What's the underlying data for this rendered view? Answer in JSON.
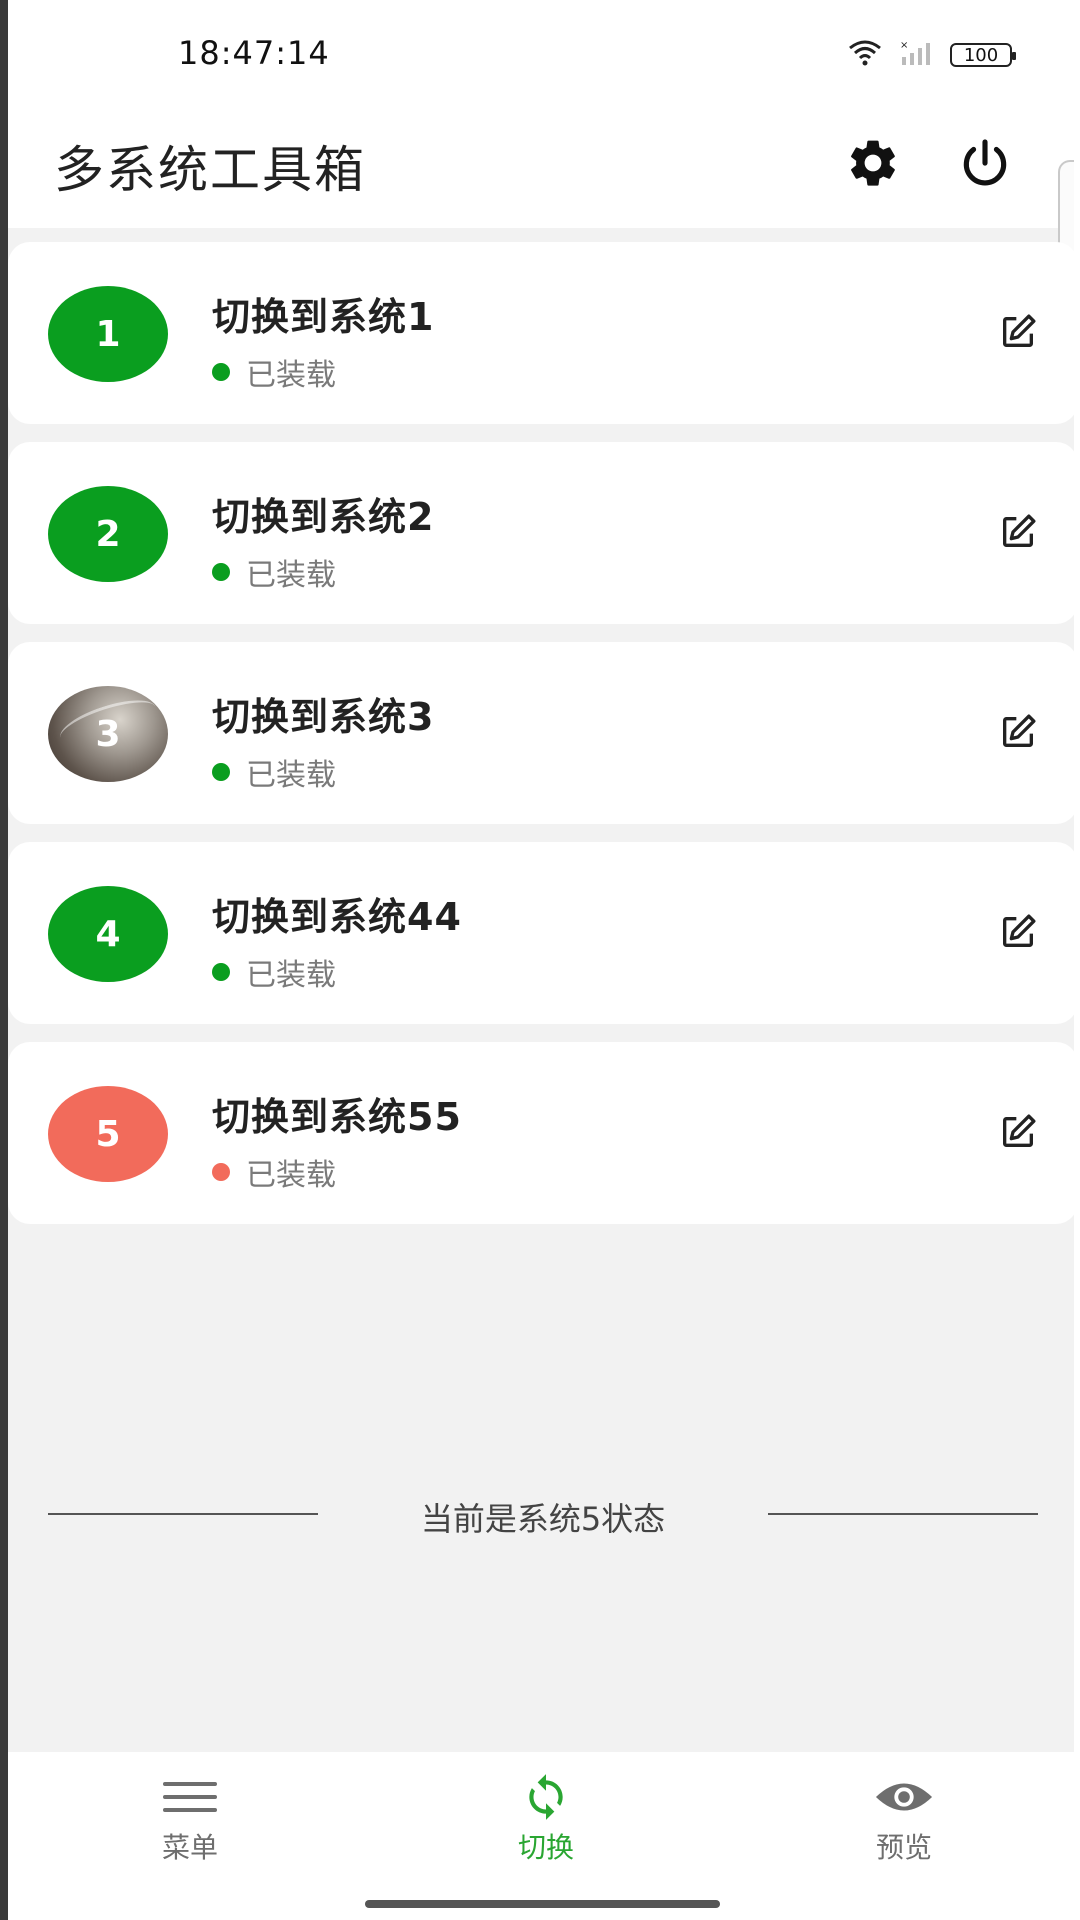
{
  "status_bar": {
    "time": "18:47:14",
    "battery": "100",
    "icons": [
      "wifi-icon",
      "signal-icon",
      "battery-icon"
    ]
  },
  "header": {
    "title": "多系统工具箱",
    "settings_icon": "gear-icon",
    "power_icon": "power-icon"
  },
  "systems": [
    {
      "badge": "1",
      "title": "切换到系统1",
      "status": "已装载",
      "badge_color": "#0a9e1f",
      "dot_color": "#0a9e1f",
      "avatar_type": "number"
    },
    {
      "badge": "2",
      "title": "切换到系统2",
      "status": "已装载",
      "badge_color": "#0a9e1f",
      "dot_color": "#0a9e1f",
      "avatar_type": "number"
    },
    {
      "badge": "3",
      "title": "切换到系统3",
      "status": "已装载",
      "badge_color": "#7a6a5e",
      "dot_color": "#0a9e1f",
      "avatar_type": "photo"
    },
    {
      "badge": "4",
      "title": "切换到系统44",
      "status": "已装载",
      "badge_color": "#0a9e1f",
      "dot_color": "#0a9e1f",
      "avatar_type": "number"
    },
    {
      "badge": "5",
      "title": "切换到系统55",
      "status": "已装载",
      "badge_color": "#f26b5b",
      "dot_color": "#f26b5b",
      "avatar_type": "number"
    }
  ],
  "current_state": "当前是系统5状态",
  "bottom_nav": [
    {
      "label": "菜单",
      "icon": "menu-icon",
      "active": false
    },
    {
      "label": "切换",
      "icon": "sync-icon",
      "active": true
    },
    {
      "label": "预览",
      "icon": "eye-icon",
      "active": false
    }
  ],
  "colors": {
    "accent": "#2aa632",
    "loaded": "#0a9e1f",
    "current": "#f26b5b",
    "background": "#f2f2f2"
  }
}
